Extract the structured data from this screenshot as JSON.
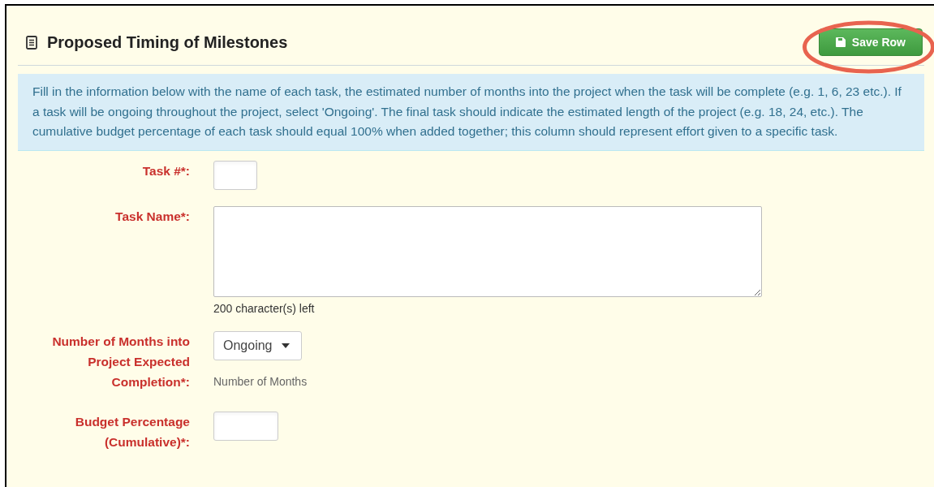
{
  "panel": {
    "title": "Proposed Timing of Milestones",
    "save_button": "Save Row",
    "save_button_highlighted": true,
    "info": "Fill in the information below with the name of each task, the estimated number of months into the project when the task will be complete (e.g. 1, 6, 23 etc.). If a task will be ongoing throughout the project, select 'Ongoing'. The final task should indicate the estimated length of the project (e.g. 18, 24, etc.). The cumulative budget percentage of each task should equal 100% when added together; this column should represent effort given to a specific task."
  },
  "fields": [
    {
      "kind": "short",
      "label": "Task #*:"
    },
    {
      "kind": "textarea",
      "label": "Task Name*:",
      "counter": "200 character(s) left"
    },
    {
      "kind": "select",
      "label": "Number of Months into Project Expected Completion*:",
      "value": "Ongoing",
      "help": "Number of Months"
    },
    {
      "kind": "medium",
      "label": "Budget Percentage (Cumulative)*:"
    }
  ]
}
